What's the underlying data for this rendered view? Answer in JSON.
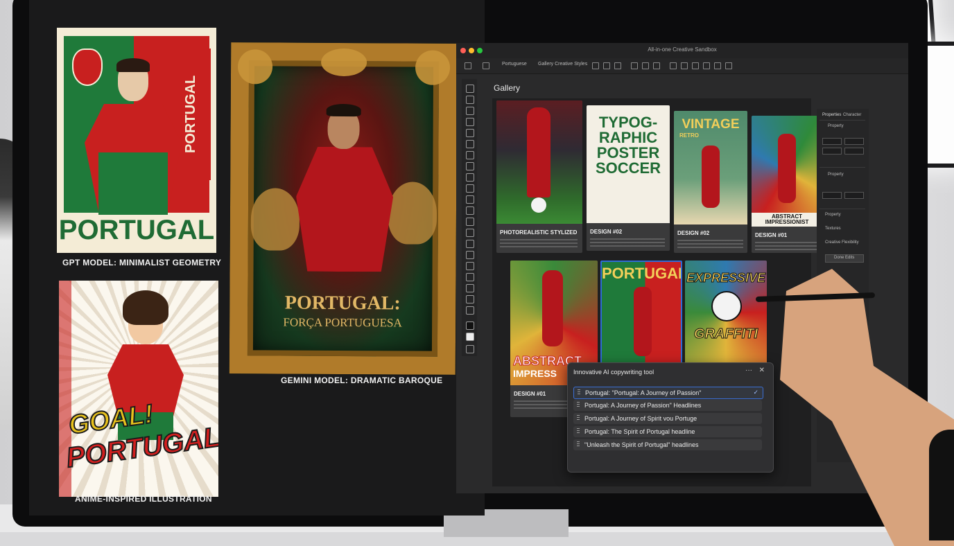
{
  "showcase": {
    "gpt": {
      "poster_vertical": "PORTUGAL",
      "poster_word": "PORTUGAL",
      "caption": "GPT MODEL: MINIMALIST GEOMETRY"
    },
    "gemini": {
      "title": "PORTUGAL:",
      "subtitle": "FORÇA PORTUGUESA",
      "caption": "GEMINI MODEL: DRAMATIC BAROQUE"
    },
    "anime": {
      "line1": "GOAL!",
      "line2": "PORTUGAL!",
      "caption": "ANIME-INSPIRED ILLUSTRATION"
    }
  },
  "app": {
    "window_title": "All-in-one Creative Sandbox",
    "toolbar": {
      "dropdown1": "Portuguese",
      "dropdown2": "Gallery Creative Styles"
    },
    "gallery_title": "Gallery",
    "cards_row1": [
      {
        "label": "PHOTOREALISTIC STYLIZED"
      },
      {
        "label": "DESIGN #02",
        "art_text": "TYPOG-RAPHIC POSTER SOCCER"
      },
      {
        "label": "DESIGN #02",
        "art_text1": "VINTAGE",
        "art_text2": "RETRO"
      },
      {
        "label": "DESIGN #01",
        "art_text": "ABSTRACT IMPRESSIONIST"
      }
    ],
    "cards_row2": [
      {
        "label": "DESIGN #01",
        "art_text1": "ABSTRACT",
        "art_text2": "IMPRESS"
      },
      {
        "art_text": "PORTUGAL"
      },
      {
        "art_text1": "EXPRESSIVE",
        "art_text2": "GRAFFITI"
      }
    ],
    "properties": {
      "tab1": "Properties",
      "tab2": "Character",
      "section1": "Property",
      "section2": "Property",
      "section3": "Textures",
      "section4": "Creative Flexibility",
      "button": "Done Edits"
    }
  },
  "popup": {
    "title": "Innovative AI copywriting tool",
    "more": "···",
    "close": "✕",
    "options": [
      "Portugal: \"Portugal: A Journey of Passion\"",
      "Portugal: A Journey of Passion\" Headlines",
      "Portugal: A Journey of Spirit vou Portuge",
      "Portugal: The Spirit of Portugal headline",
      "\"Unleash the Spirit of Portugal\" headlines"
    ],
    "selected_index": 0,
    "check": "✓"
  },
  "colors": {
    "accent": "#3b6fd6",
    "portugal_red": "#c8201f",
    "portugal_green": "#1f7a3a"
  }
}
